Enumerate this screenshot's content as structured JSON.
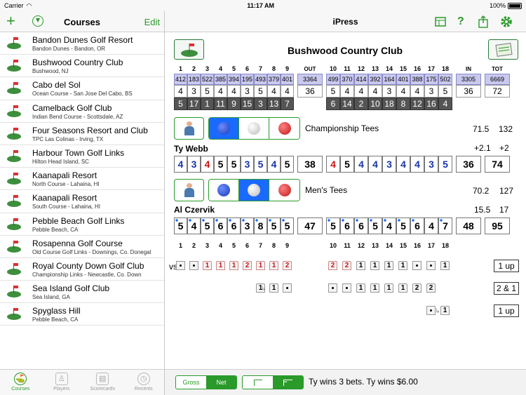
{
  "status": {
    "carrier": "Carrier",
    "time": "11:17 AM",
    "battery": "100%"
  },
  "left_nav": {
    "title": "Courses",
    "edit": "Edit"
  },
  "right_nav": {
    "title": "iPress"
  },
  "courses": [
    {
      "name": "Bandon Dunes Golf Resort",
      "sub": "Bandon Dunes - Bandon, OR"
    },
    {
      "name": "Bushwood Country Club",
      "sub": "Bushwood, NJ"
    },
    {
      "name": "Cabo del Sol",
      "sub": "Ocean Course - San Jose Del Cabo, BS"
    },
    {
      "name": "Camelback Golf Club",
      "sub": "Indian Bend Course - Scottsdale, AZ"
    },
    {
      "name": "Four Seasons Resort and Club",
      "sub": "TPC Las Colinas - Irving, TX"
    },
    {
      "name": "Harbour Town Golf Links",
      "sub": "Hilton Head Island, SC"
    },
    {
      "name": "Kaanapali Resort",
      "sub": "North Course - Lahaina, HI"
    },
    {
      "name": "Kaanapali Resort",
      "sub": "South Course - Lahaina, HI"
    },
    {
      "name": "Pebble Beach Golf Links",
      "sub": "Pebble Beach, CA"
    },
    {
      "name": "Rosapenna Golf Course",
      "sub": "Old Course Golf Links - Downings, Co. Donegal"
    },
    {
      "name": "Royal County Down Golf Club",
      "sub": "Championship Links - Newcastle, Co. Down"
    },
    {
      "name": "Sea Island Golf Club",
      "sub": "Sea Island, GA"
    },
    {
      "name": "Spyglass Hill",
      "sub": "Pebble Beach, CA"
    }
  ],
  "tabs": [
    "Courses",
    "Players",
    "Scorecards",
    "Recents"
  ],
  "scorecard": {
    "club": "Bushwood Country Club",
    "headers": [
      "1",
      "2",
      "3",
      "4",
      "5",
      "6",
      "7",
      "8",
      "9",
      "OUT",
      "10",
      "11",
      "12",
      "13",
      "14",
      "15",
      "16",
      "17",
      "18",
      "IN",
      "TOT"
    ],
    "yards": [
      "412",
      "183",
      "522",
      "385",
      "394",
      "195",
      "493",
      "379",
      "401",
      "3364",
      "499",
      "370",
      "414",
      "392",
      "164",
      "401",
      "388",
      "175",
      "502",
      "3305",
      "6669"
    ],
    "par": [
      "4",
      "3",
      "5",
      "4",
      "4",
      "3",
      "5",
      "4",
      "4",
      "36",
      "5",
      "4",
      "4",
      "4",
      "3",
      "4",
      "4",
      "3",
      "5",
      "36",
      "72"
    ],
    "hcp": [
      "5",
      "17",
      "1",
      "11",
      "9",
      "15",
      "3",
      "13",
      "7",
      "",
      "6",
      "14",
      "2",
      "10",
      "18",
      "8",
      "12",
      "16",
      "4",
      "",
      ""
    ],
    "tee1": {
      "name": "Championship Tees",
      "rating": "71.5",
      "slope": "132"
    },
    "player1": {
      "name": "Ty Webb",
      "hcp1": "+2.1",
      "hcp2": "+2",
      "scores": [
        "4",
        "3",
        "4",
        "5",
        "5",
        "3",
        "5",
        "4",
        "5",
        "38",
        "4",
        "5",
        "4",
        "4",
        "3",
        "4",
        "4",
        "3",
        "5",
        "36",
        "74"
      ]
    },
    "tee2": {
      "name": "Men's Tees",
      "rating": "70.2",
      "slope": "127"
    },
    "player2": {
      "name": "Al Czervik",
      "hcp1": "15.5",
      "hcp2": "17",
      "scores": [
        "5",
        "4",
        "5",
        "6",
        "6",
        "3",
        "8",
        "5",
        "5",
        "47",
        "5",
        "6",
        "6",
        "5",
        "4",
        "5",
        "6",
        "4",
        "7",
        "48",
        "95"
      ]
    },
    "vs": "vs.",
    "bet_rows": [
      {
        "front": [
          "•",
          "•",
          "1",
          "1",
          "1",
          "2",
          "1",
          "1",
          "2"
        ],
        "back": [
          "2",
          "2",
          "1",
          "1",
          "1",
          "1",
          "•",
          "•",
          "1"
        ],
        "result": "1 up"
      },
      {
        "front": [
          "",
          "",
          "",
          "",
          "",
          "",
          "1",
          "1",
          "•"
        ],
        "back": [
          "•",
          "•",
          "1",
          "1",
          "1",
          "1",
          "2",
          "2",
          ""
        ],
        "result": "2 & 1"
      },
      {
        "front": [],
        "back": [
          "",
          "",
          "",
          "",
          "",
          "",
          "",
          "•",
          "1"
        ],
        "result": "1 up"
      }
    ]
  },
  "bottom": {
    "gross": "Gross",
    "net": "Net",
    "result": "Ty wins 3 bets.  Ty wins $6.00"
  },
  "colors": {
    "accent": "#2a9a2a",
    "yardage": "#c9c9ee",
    "hcp": "#555555"
  }
}
